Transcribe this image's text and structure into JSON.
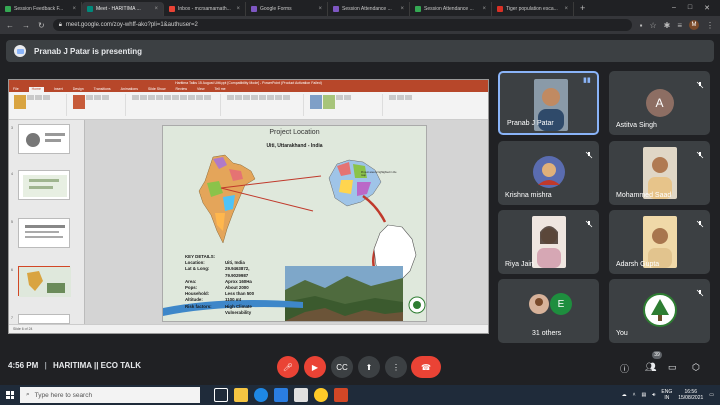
{
  "browser": {
    "tabs": [
      {
        "label": "Session Feedback F...",
        "color": "#34a853"
      },
      {
        "label": "Meet - HARITIMA ...",
        "color": "#00897b",
        "active": true
      },
      {
        "label": "Inbox - mcrsamarnath...",
        "color": "#ea4335"
      },
      {
        "label": "Google Forms",
        "color": "#7e57c2"
      },
      {
        "label": "Session Attendance ...",
        "color": "#7e57c2"
      },
      {
        "label": "Session Attendance ...",
        "color": "#34a853"
      },
      {
        "label": "Tiger population esca...",
        "color": "#d93025"
      }
    ],
    "url": "meet.google.com/zoy-whff-ako?pli=1&authuser=2",
    "profile_initial": "M"
  },
  "presenting_banner": "Pranab J Patar is presenting",
  "presentation": {
    "window_title": "Haritima Talks 15 August Uitti.ppt [Compatibility Mode] - PowerPoint (Product Activation Failed)",
    "ribbon_tabs": [
      "File",
      "Home",
      "Insert",
      "Design",
      "Transitions",
      "Animations",
      "Slide Show",
      "Review",
      "View",
      "Tell me"
    ],
    "slide_title": "Project Location",
    "slide_subtitle": "Uiti, Uttarakhand - India",
    "key_details_heading": "KEY DETAILS:",
    "key_details": [
      {
        "k": "Location:",
        "v": "Uiti, India"
      },
      {
        "k": "Lat & Long:",
        "v": "29.9463872, 79.9029987"
      },
      {
        "k": "Area:",
        "v": "Aprox 160Ha"
      },
      {
        "k": "Pops:",
        "v": "About 2000"
      },
      {
        "k": "Household:",
        "v": "Less than 500"
      },
      {
        "k": "Altitude:",
        "v": "1100 mt"
      },
      {
        "k": "Risk factors:",
        "v": "High Climate Vulnerability"
      }
    ],
    "caption": "Project area is highlighted in the map",
    "status": "Slide 6 of 24"
  },
  "participants": [
    {
      "name": "Pranab J Patar",
      "speaking": true,
      "color": "#6b7b8c"
    },
    {
      "name": "Astitva Singh",
      "initial": "A",
      "color": "#8d6e63"
    },
    {
      "name": "Krishna mishra",
      "color": "#5a6cb0"
    },
    {
      "name": "Mohammed Saad",
      "color": "#b9a27a"
    },
    {
      "name": "Riya Jain",
      "color": "#e0c9b5"
    },
    {
      "name": "Adarsh Gupta",
      "color": "#e2c48e"
    },
    {
      "name": "31 others",
      "initial": "E",
      "color": "#1e8e3e"
    },
    {
      "name": "You",
      "color": "#ffffff"
    }
  ],
  "meeting": {
    "time": "4:56 PM",
    "separator": "|",
    "title": "HARITIMA || ECO TALK",
    "people_count": "39"
  },
  "taskbar": {
    "search_placeholder": "Type here to search",
    "lang": "ENG",
    "region": "IN",
    "clock_time": "16:56",
    "clock_date": "15/08/2021"
  }
}
